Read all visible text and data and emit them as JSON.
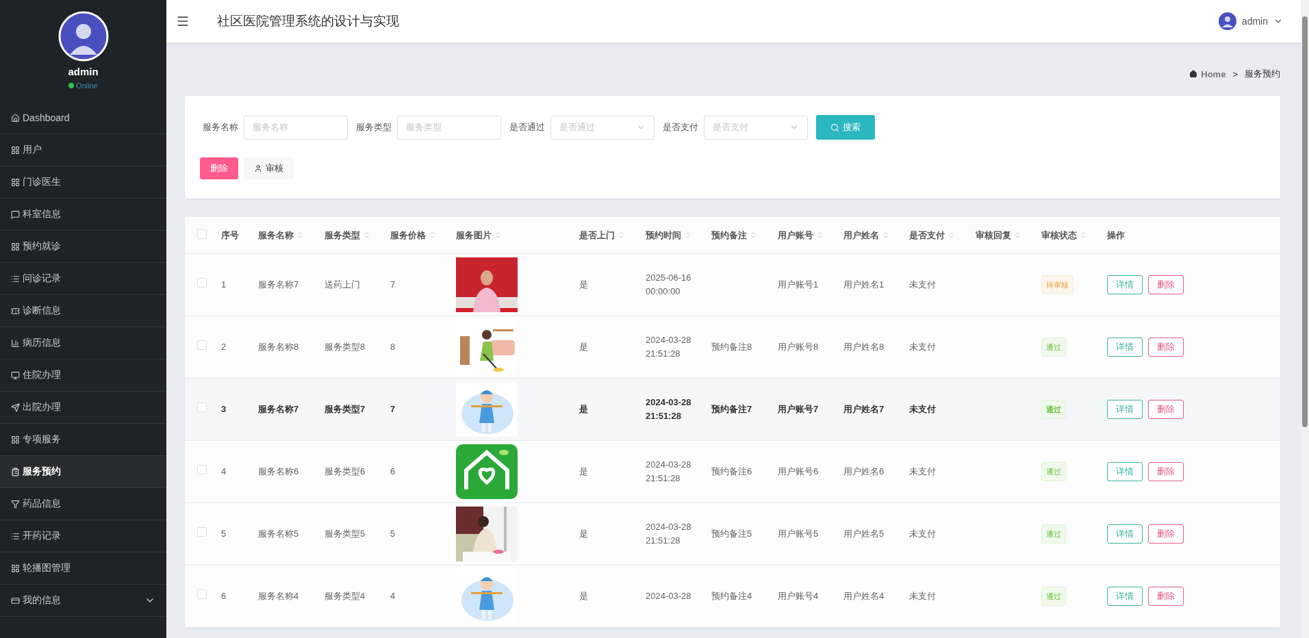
{
  "sidebar": {
    "user": {
      "name": "admin",
      "status": "Online"
    },
    "items": [
      {
        "label": "Dashboard",
        "selected": false
      },
      {
        "label": "用户",
        "selected": false
      },
      {
        "label": "门诊医生",
        "selected": false
      },
      {
        "label": "科室信息",
        "selected": false
      },
      {
        "label": "预约就诊",
        "selected": false
      },
      {
        "label": "问诊记录",
        "selected": false
      },
      {
        "label": "诊断信息",
        "selected": false
      },
      {
        "label": "病历信息",
        "selected": false
      },
      {
        "label": "住院办理",
        "selected": false
      },
      {
        "label": "出院办理",
        "selected": false
      },
      {
        "label": "专项服务",
        "selected": false
      },
      {
        "label": "服务预约",
        "selected": true
      },
      {
        "label": "药品信息",
        "selected": false
      },
      {
        "label": "开药记录",
        "selected": false
      },
      {
        "label": "轮播图管理",
        "selected": false
      },
      {
        "label": "我的信息",
        "selected": false,
        "expanded": false
      }
    ]
  },
  "header": {
    "title": "社区医院管理系统的设计与实现",
    "user": "admin"
  },
  "breadcrumb": {
    "home": "Home",
    "separator": ">",
    "current": "服务预约"
  },
  "search": {
    "fields": [
      {
        "label": "服务名称",
        "placeholder": "服务名称",
        "kind": "input"
      },
      {
        "label": "服务类型",
        "placeholder": "服务类型",
        "kind": "input"
      },
      {
        "label": "是否通过",
        "placeholder": "是否通过",
        "kind": "select"
      },
      {
        "label": "是否支付",
        "placeholder": "是否支付",
        "kind": "select"
      }
    ],
    "button": "搜索"
  },
  "actions": [
    {
      "label": "删除",
      "kind": "danger"
    },
    {
      "label": "审核",
      "kind": "plain"
    }
  ],
  "table": {
    "header_checked": false,
    "columns": [
      {
        "label": "序号",
        "sortable": false
      },
      {
        "label": "服务名称",
        "sortable": true
      },
      {
        "label": "服务类型",
        "sortable": true
      },
      {
        "label": "服务价格",
        "sortable": true
      },
      {
        "label": "服务图片",
        "sortable": true
      },
      {
        "label": "是否上门",
        "sortable": true
      },
      {
        "label": "预约时间",
        "sortable": true
      },
      {
        "label": "预约备注",
        "sortable": true
      },
      {
        "label": "用户账号",
        "sortable": true
      },
      {
        "label": "用户姓名",
        "sortable": true
      },
      {
        "label": "是否支付",
        "sortable": true
      },
      {
        "label": "审核回复",
        "sortable": true
      },
      {
        "label": "审核状态",
        "sortable": true
      },
      {
        "label": "操作",
        "sortable": false
      }
    ],
    "rows": [
      {
        "checked": false,
        "selected": false,
        "index": "1",
        "name": "服务名称7",
        "type": "送药上门",
        "price": "7",
        "home": "是",
        "time": "2025-06-16 00:00:00",
        "account": "用户账号1",
        "user": "用户姓名1",
        "paid": "未支付",
        "status": {
          "label": "待审核",
          "kind": "pending"
        },
        "buttons": [
          "详情",
          "删除"
        ]
      },
      {
        "checked": false,
        "selected": false,
        "index": "2",
        "name": "服务名称8",
        "type": "服务类型8",
        "price": "8",
        "home": "是",
        "time": "2024-03-28 21:51:28",
        "note": "预约备注8",
        "account": "用户账号8",
        "user": "用户姓名8",
        "paid": "未支付",
        "status": {
          "label": "通过",
          "kind": "approved"
        },
        "buttons": [
          "详情",
          "删除"
        ]
      },
      {
        "checked": false,
        "selected": true,
        "index": "3",
        "name": "服务名称7",
        "type": "服务类型7",
        "price": "7",
        "home": "是",
        "time": "2024-03-28 21:51:28",
        "note": "预约备注7",
        "account": "用户账号7",
        "user": "用户姓名7",
        "paid": "未支付",
        "status": {
          "label": "通过",
          "kind": "approved"
        },
        "buttons": [
          "详情",
          "删除"
        ]
      },
      {
        "checked": false,
        "selected": false,
        "index": "4",
        "name": "服务名称6",
        "type": "服务类型6",
        "price": "6",
        "home": "是",
        "time": "2024-03-28 21:51:28",
        "note": "预约备注6",
        "account": "用户账号6",
        "user": "用户姓名6",
        "paid": "未支付",
        "status": {
          "label": "通过",
          "kind": "approved"
        },
        "buttons": [
          "详情",
          "删除"
        ]
      },
      {
        "checked": false,
        "selected": false,
        "index": "5",
        "name": "服务名称5",
        "type": "服务类型5",
        "price": "5",
        "home": "是",
        "time": "2024-03-28 21:51:28",
        "note": "预约备注5",
        "account": "用户账号5",
        "user": "用户姓名5",
        "paid": "未支付",
        "status": {
          "label": "通过",
          "kind": "approved"
        },
        "buttons": [
          "详情",
          "删除"
        ]
      },
      {
        "checked": false,
        "selected": false,
        "index": "6",
        "name": "服务名称4",
        "type": "服务类型4",
        "price": "4",
        "home": "是",
        "time": "2024-03-28",
        "note": "预约备注4",
        "account": "用户账号4",
        "user": "用户姓名4",
        "paid": "未支付",
        "status": {
          "label": "通过",
          "kind": "approved"
        },
        "buttons": [
          "详情",
          "删除"
        ]
      }
    ]
  }
}
